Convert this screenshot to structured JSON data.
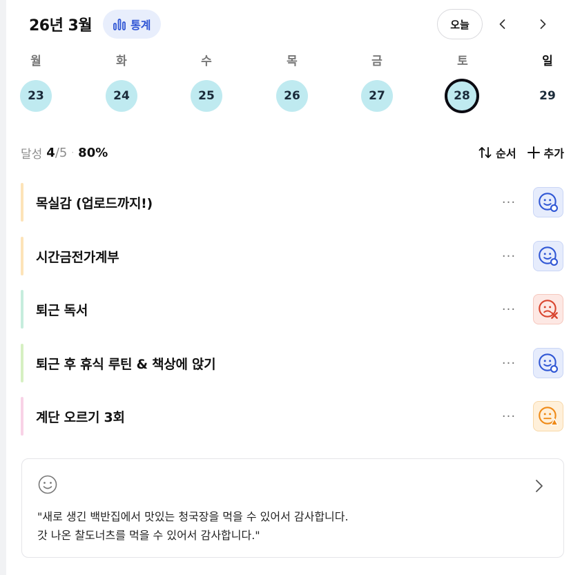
{
  "header": {
    "month_title": "26년 3월",
    "stats_label": "통계",
    "today_label": "오늘",
    "accent_color": "#2f55d4"
  },
  "week": {
    "weekdays": [
      "월",
      "화",
      "수",
      "목",
      "금",
      "토",
      "일"
    ],
    "dates": [
      "23",
      "24",
      "25",
      "26",
      "27",
      "28",
      "29"
    ],
    "selected_date": "28",
    "filled_color": "#bfeaf0"
  },
  "summary": {
    "label": "달성",
    "done": "4",
    "slash": "/",
    "total": "5",
    "dot": "·",
    "percent": "80%",
    "sort_label": "순서",
    "add_label": "추가"
  },
  "habits": [
    {
      "name": "목실감 (업로드까지!)",
      "bar_color": "#fde3b8",
      "status": "done",
      "more": "···"
    },
    {
      "name": "시간금전가계부",
      "bar_color": "#fde3b8",
      "status": "done",
      "more": "···"
    },
    {
      "name": "퇴근 독서",
      "bar_color": "#c6eddd",
      "status": "fail",
      "more": "···"
    },
    {
      "name": "퇴근 후 휴식 루틴 & 책상에 앉기",
      "bar_color": "#d6f0c2",
      "status": "done",
      "more": "···"
    },
    {
      "name": "계단 오르기 3회",
      "bar_color": "#f8d2e6",
      "status": "partial",
      "more": "···"
    }
  ],
  "gratitude": {
    "lines": [
      "\"새로 생긴 백반집에서 맛있는 청국장을 먹을 수 있어서 감사합니다.",
      "갓 나온 찰도너츠를 먹을 수 있어서 감사합니다.\""
    ]
  },
  "status_colors": {
    "done": {
      "bg": "#e6ecfc",
      "border": "#c9d5f6",
      "fg": "#3057d5"
    },
    "fail": {
      "bg": "#fde8e4",
      "border": "#f6c7bd",
      "fg": "#d9452f"
    },
    "partial": {
      "bg": "#fff0da",
      "border": "#f8d8a8",
      "fg": "#ef8a17"
    }
  }
}
